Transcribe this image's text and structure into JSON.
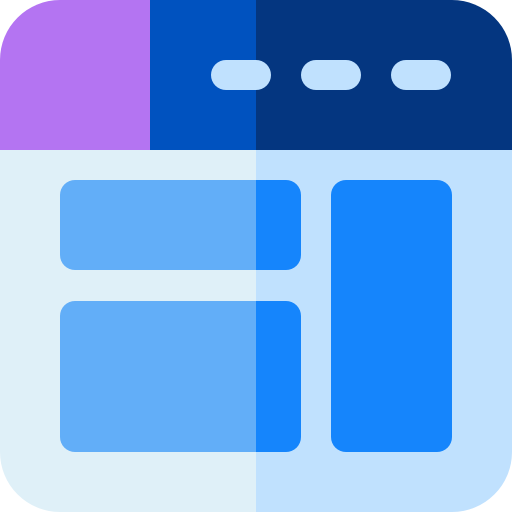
{
  "icon": {
    "name": "browser-layout-icon",
    "colors": {
      "tab_purple": "#B474F2",
      "header_blue": "#0052BF",
      "header_navy": "#043680",
      "body_light_left": "#DFF0F8",
      "body_light_right": "#C0E1FE",
      "dot_fill": "#C0E1FE",
      "panel_light_blue": "#62AEF8",
      "panel_bright_blue": "#1585FC"
    }
  }
}
